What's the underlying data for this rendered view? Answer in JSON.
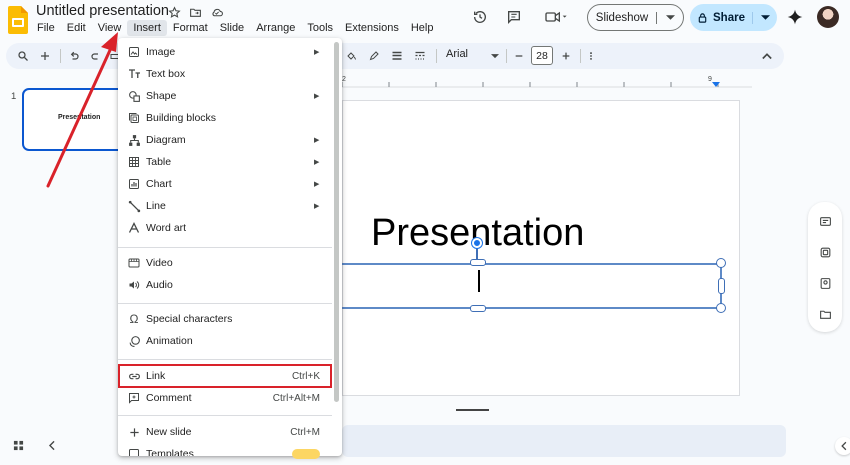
{
  "doc": {
    "title": "Untitled presentation"
  },
  "menubar": [
    "File",
    "Edit",
    "View",
    "Insert",
    "Format",
    "Slide",
    "Arrange",
    "Tools",
    "Extensions",
    "Help"
  ],
  "header": {
    "slideshow_label": "Slideshow",
    "share_label": "Share"
  },
  "toolbar": {
    "font_name": "Arial",
    "font_size": "28"
  },
  "filmstrip": {
    "slide_number": "1",
    "thumb_text": "Presentation"
  },
  "slide": {
    "title_text": "Presentation"
  },
  "insert_menu": {
    "items": [
      {
        "label": "Image",
        "submenu": true,
        "icon": "image-icon"
      },
      {
        "label": "Text box",
        "submenu": false,
        "icon": "text-box-icon"
      },
      {
        "label": "Shape",
        "submenu": true,
        "icon": "shape-icon"
      },
      {
        "label": "Building blocks",
        "submenu": false,
        "icon": "building-blocks-icon"
      },
      {
        "label": "Diagram",
        "submenu": true,
        "icon": "diagram-icon"
      },
      {
        "label": "Table",
        "submenu": true,
        "icon": "table-icon"
      },
      {
        "label": "Chart",
        "submenu": true,
        "icon": "chart-icon"
      },
      {
        "label": "Line",
        "submenu": true,
        "icon": "line-icon"
      },
      {
        "label": "Word art",
        "submenu": false,
        "icon": "word-art-icon"
      },
      {
        "label": "Video",
        "submenu": false,
        "icon": "video-icon"
      },
      {
        "label": "Audio",
        "submenu": false,
        "icon": "audio-icon"
      },
      {
        "label": "Special characters",
        "submenu": false,
        "icon": "omega-icon"
      },
      {
        "label": "Animation",
        "submenu": false,
        "icon": "animation-icon"
      },
      {
        "label": "Link",
        "shortcut": "Ctrl+K",
        "icon": "link-icon"
      },
      {
        "label": "Comment",
        "shortcut": "Ctrl+Alt+M",
        "icon": "comment-icon"
      },
      {
        "label": "New slide",
        "shortcut": "Ctrl+M",
        "icon": "plus-icon"
      },
      {
        "label": "Templates",
        "icon": "templates-icon"
      }
    ]
  },
  "colors": {
    "accent": "#0b57d0",
    "share_bg": "#c2e7ff",
    "highlight": "#d9222a",
    "toolbar_bg": "#edf2fa"
  }
}
